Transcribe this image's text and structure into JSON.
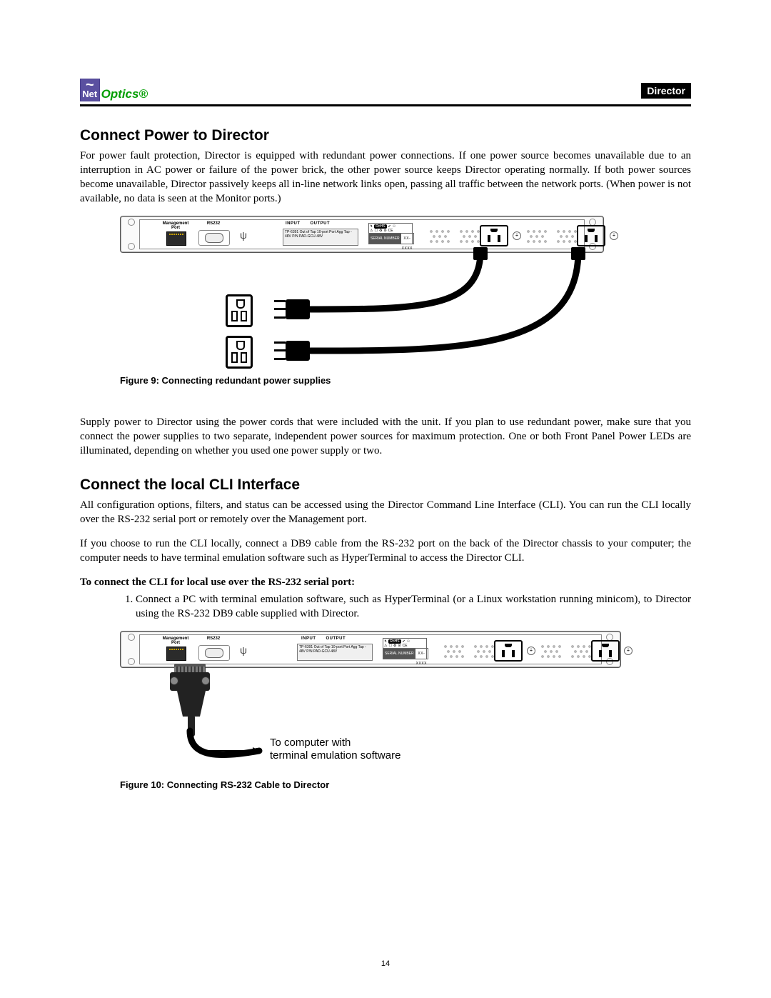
{
  "header": {
    "logo_net": "Net",
    "logo_optics": "Optics®",
    "doc_title": "Director"
  },
  "page_number": "14",
  "sections": {
    "power": {
      "heading": "Connect Power to Director",
      "para1": "For power fault protection, Director is equipped with redundant power connections. If one power source becomes unavailable due to an interruption in AC power or failure of the power brick, the other power source keeps Director operating normally. If both power sources become unavailable, Director passively keeps all in-line network links open, passing all traffic between the network ports. (When power is not available, no data is seen at the Monitor ports.)",
      "fig_caption": "Figure 9: Connecting redundant power supplies",
      "para2": "Supply power to Director using the power cords that were included with the unit. If you plan to use redundant power, make sure that you connect the power supplies to two separate, independent power sources for maximum protection. One or both Front Panel Power LEDs are illuminated, depending on whether you used one power supply or two."
    },
    "cli": {
      "heading": "Connect the local CLI Interface",
      "para1": "All configuration options, filters, and status can be accessed using the Director Command Line Interface (CLI). You can run the CLI locally over the RS-232 serial port or remotely over the Management port.",
      "para2": "If you choose to run the CLI locally, connect a DB9 cable from the RS-232 port on the back of the Director chassis to your computer; the computer needs to have terminal emulation software such as HyperTerminal to access the Director CLI.",
      "subhead": "To connect the CLI for local use over the RS-232 serial port:",
      "step1": "Connect a PC with terminal emulation software, such as HyperTerminal (or a Linux workstation running minicom), to Director using the RS-232 DB9 cable supplied with Director.",
      "fig_caption": "Figure 10: Connecting RS-232 Cable to Director",
      "annotation_line1": "To computer with",
      "annotation_line2": "terminal emulation software"
    }
  },
  "chassis_labels": {
    "mgmt": "Management\nPort",
    "rs232": "RS232",
    "input": "INPUT",
    "output": "OUTPUT",
    "serial_key": "SERIAL\nNUMBER",
    "serial_val": "XX-XXXX",
    "rohs": "RoHS",
    "info_text": "TP-6391 Out of Tap 10-port Port Agg Tap - 48V\nP/N PAD-GCU-48V"
  }
}
